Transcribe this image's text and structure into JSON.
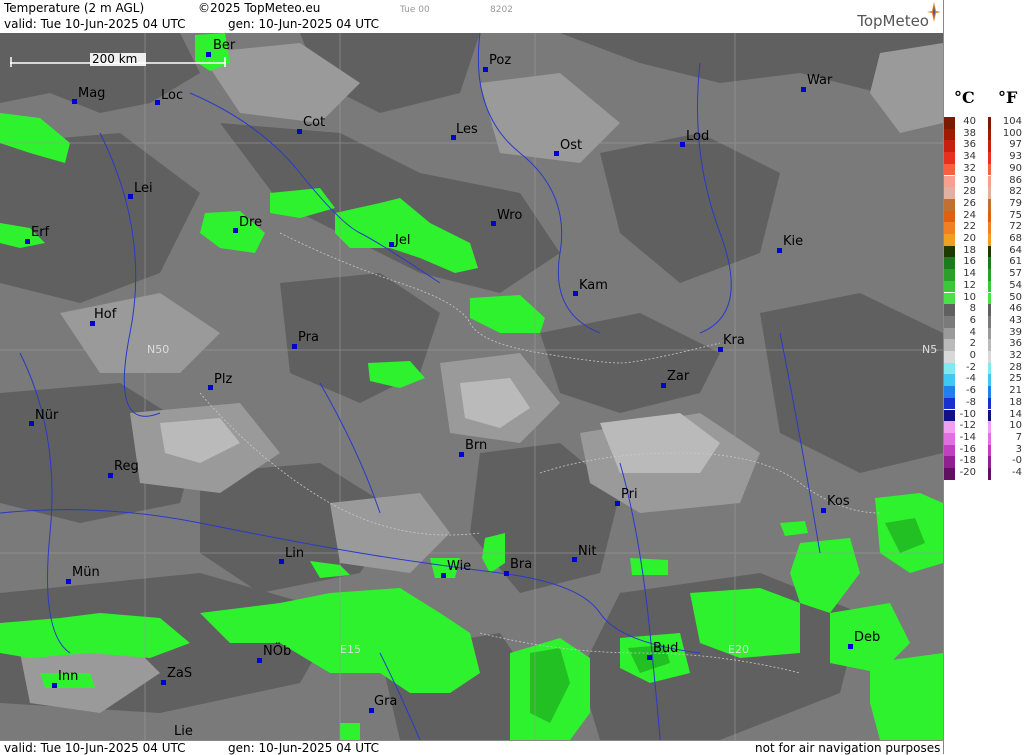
{
  "header": {
    "title": "Temperature (2 m AGL)",
    "copyright": "©2025 TopMeteo.eu",
    "valid": "valid:  Tue  10-Jun-2025  04 UTC",
    "gen": "gen: 10-Jun-2025  04 UTC",
    "day_code": "Tue 00",
    "run_code": "8202",
    "logo": "TopMeteo"
  },
  "footer": {
    "valid": "valid:  Tue  10-Jun-2025  04 UTC",
    "gen": "gen: 10-Jun-2025  04 UTC",
    "disclaimer": "not for air navigation purposes"
  },
  "scale": {
    "label": "200 km"
  },
  "grid_labels": [
    "N50",
    "N5",
    "E15",
    "E20"
  ],
  "legend": {
    "celsius_unit": "°C",
    "fahrenheit_unit": "°F",
    "celsius": [
      "40",
      "38",
      "36",
      "34",
      "32",
      "30",
      "28",
      "26",
      "24",
      "22",
      "20",
      "18",
      "16",
      "14",
      "12",
      "10",
      "8",
      "6",
      "4",
      "2",
      "0",
      "-2",
      "-4",
      "-6",
      "-8",
      "-10",
      "-12",
      "-14",
      "-16",
      "-18",
      "-20"
    ],
    "fahrenheit": [
      "104",
      "100",
      "97",
      "93",
      "90",
      "86",
      "82",
      "79",
      "75",
      "72",
      "68",
      "64",
      "61",
      "57",
      "54",
      "50",
      "46",
      "43",
      "39",
      "36",
      "32",
      "28",
      "25",
      "21",
      "18",
      "14",
      "10",
      "7",
      "3",
      "-0",
      "-4"
    ],
    "colors": [
      "#7a1a00",
      "#a01a00",
      "#c82010",
      "#e83020",
      "#f86040",
      "#f8a090",
      "#e0b0a0",
      "#c07030",
      "#e06010",
      "#f08020",
      "#f0a020",
      "#1e3a00",
      "#1e7a1e",
      "#2aa02a",
      "#38c838",
      "#4ae04a",
      "#606060",
      "#7a7a7a",
      "#9a9a9a",
      "#bababa",
      "#d8d8d8",
      "#80e8f0",
      "#40c8f0",
      "#2080f0",
      "#1830d0",
      "#101080",
      "#f0a0f0",
      "#e070e0",
      "#c040c0",
      "#902090",
      "#601060"
    ]
  },
  "cities": [
    {
      "name": "Ber"
    },
    {
      "name": "Poz"
    },
    {
      "name": "War"
    },
    {
      "name": "Mag"
    },
    {
      "name": "Loc"
    },
    {
      "name": "Cot"
    },
    {
      "name": "Les"
    },
    {
      "name": "Ost"
    },
    {
      "name": "Lod"
    },
    {
      "name": "Lei"
    },
    {
      "name": "Dre"
    },
    {
      "name": "Wro"
    },
    {
      "name": "Erf"
    },
    {
      "name": "Jel"
    },
    {
      "name": "Kie"
    },
    {
      "name": "Kam"
    },
    {
      "name": "Hof"
    },
    {
      "name": "Pra"
    },
    {
      "name": "Kra"
    },
    {
      "name": "Zar"
    },
    {
      "name": "Plz"
    },
    {
      "name": "Nür"
    },
    {
      "name": "Brn"
    },
    {
      "name": "Reg"
    },
    {
      "name": "Pri"
    },
    {
      "name": "Kos"
    },
    {
      "name": "Lin"
    },
    {
      "name": "Wie"
    },
    {
      "name": "Bra"
    },
    {
      "name": "Nit"
    },
    {
      "name": "Mün"
    },
    {
      "name": "NÖb"
    },
    {
      "name": "Bud"
    },
    {
      "name": "Deb"
    },
    {
      "name": "Inn"
    },
    {
      "name": "ZaS"
    },
    {
      "name": "Gra"
    },
    {
      "name": "Lie"
    }
  ]
}
